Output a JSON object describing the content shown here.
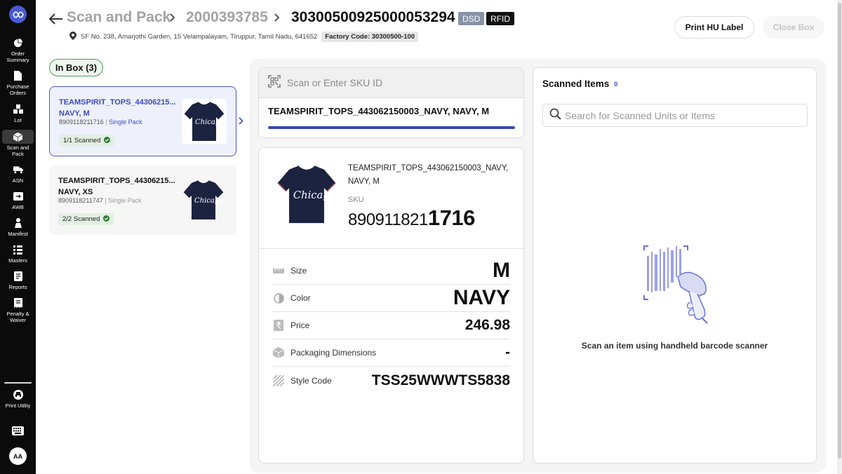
{
  "sidebar": {
    "items": [
      {
        "label": "Order Summary",
        "icon": "pie-chart-icon"
      },
      {
        "label": "Purchase Orders",
        "icon": "document-icon"
      },
      {
        "label": "Lot",
        "icon": "boxes-icon"
      },
      {
        "label": "Scan and Pack",
        "icon": "box-icon",
        "active": true
      },
      {
        "label": "ASN",
        "icon": "truck-icon"
      },
      {
        "label": "AWB",
        "icon": "shipping-icon"
      },
      {
        "label": "Manifest",
        "icon": "person-icon"
      },
      {
        "label": "Masters",
        "icon": "list-icon"
      },
      {
        "label": "Reports",
        "icon": "report-icon"
      },
      {
        "label": "Penalty & Waiver",
        "icon": "receipt-icon"
      }
    ],
    "print_utility": "Print Utility",
    "avatar": "AA"
  },
  "header": {
    "crumb1": "Scan and Pack",
    "crumb2": "2000393785",
    "crumb3": "30300500925000053294",
    "tag_dsd": "DSD",
    "tag_rfid": "RFID",
    "address": "SF No. 238, Amarjothi Garden, 15 Velampalayam, Tiruppur, Tamil Nadu, 641652",
    "factory_code": "Factory Code: 30300500-100",
    "print_label": "Print HU Label",
    "close_box": "Close Box"
  },
  "inbox": {
    "label": "In Box (3)",
    "cards": [
      {
        "title": "TEAMSPIRIT_TOPS_443062150003_NAVY, M",
        "title_display": "TEAMSPIRIT_TOPS_44306215...\nNAVY, M",
        "barcode": "8909118211716",
        "pack": "Single Pack",
        "scanned": "1/1 Scanned"
      },
      {
        "title": "TEAMSPIRIT_TOPS_443062150003_NAVY, XS",
        "title_display": "TEAMSPIRIT_TOPS_44306215...\nNAVY, XS",
        "barcode": "8909118211747",
        "pack": "Single Pack",
        "scanned": "2/2 Scanned"
      }
    ]
  },
  "scan": {
    "placeholder": "Scan or Enter SKU ID",
    "current": "TEAMSPIRIT_TOPS_443062150003_NAVY, NAVY, M",
    "progress": 1.0
  },
  "detail": {
    "name": "TEAMSPIRIT_TOPS_443062150003_NAVY, NAVY, M",
    "sku_label": "SKU",
    "sku_prefix": "890911821",
    "sku_suffix": "1716",
    "attributes": [
      {
        "label": "Size",
        "value": "M",
        "icon": "ruler-icon"
      },
      {
        "label": "Color",
        "value": "NAVY",
        "icon": "color-drop-icon"
      },
      {
        "label": "Price",
        "value": "246.98",
        "icon": "rupee-icon"
      },
      {
        "label": "Packaging Dimensions",
        "value": "-",
        "icon": "package-icon"
      },
      {
        "label": "Style Code",
        "value": "TSS25WWWTS5838",
        "icon": "stripes-icon"
      }
    ]
  },
  "scanned": {
    "title": "Scanned Items",
    "count": "0",
    "search_placeholder": "Search for Scanned Units or Items",
    "empty_message": "Scan an item using handheld barcode scanner"
  }
}
